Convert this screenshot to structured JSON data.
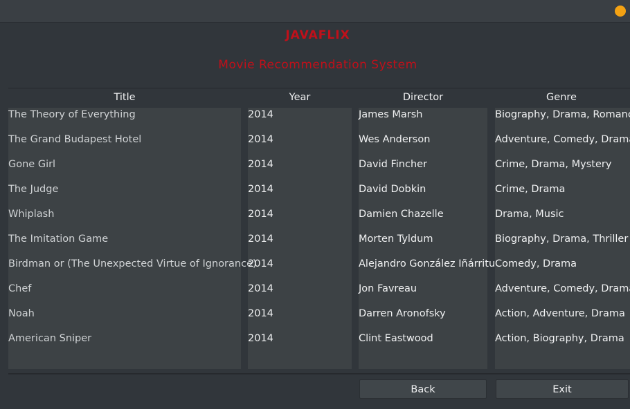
{
  "app": {
    "title": "JAVAFLIX",
    "subtitle": "Movie Recommendation System"
  },
  "table": {
    "columns": [
      "Title",
      "Year",
      "Director",
      "Genre"
    ],
    "rows": [
      {
        "title": "The Theory of Everything",
        "year": "2014",
        "director": "James Marsh",
        "genre": "Biography, Drama, Romance"
      },
      {
        "title": "The Grand Budapest Hotel",
        "year": "2014",
        "director": "Wes Anderson",
        "genre": "Adventure, Comedy, Drama"
      },
      {
        "title": "Gone Girl",
        "year": "2014",
        "director": "David Fincher",
        "genre": "Crime, Drama, Mystery"
      },
      {
        "title": "The Judge",
        "year": "2014",
        "director": "David Dobkin",
        "genre": "Crime, Drama"
      },
      {
        "title": "Whiplash",
        "year": "2014",
        "director": "Damien Chazelle",
        "genre": "Drama, Music"
      },
      {
        "title": "The Imitation Game",
        "year": "2014",
        "director": "Morten Tyldum",
        "genre": "Biography, Drama, Thriller"
      },
      {
        "title": "Birdman or (The Unexpected Virtue of Ignorance)",
        "year": "2014",
        "director": "Alejandro González Iñárritu",
        "genre": "Comedy, Drama"
      },
      {
        "title": "Chef",
        "year": "2014",
        "director": "Jon Favreau",
        "genre": "Adventure, Comedy, Drama"
      },
      {
        "title": "Noah",
        "year": "2014",
        "director": "Darren Aronofsky",
        "genre": "Action, Adventure, Drama"
      },
      {
        "title": "American Sniper",
        "year": "2014",
        "director": "Clint Eastwood",
        "genre": "Action, Biography, Drama"
      }
    ]
  },
  "buttons": {
    "back_label": "Back",
    "exit_label": "Exit"
  },
  "colors": {
    "accent_title": "#c0101a",
    "window_close": "#f4a213",
    "background": "#31363b"
  }
}
